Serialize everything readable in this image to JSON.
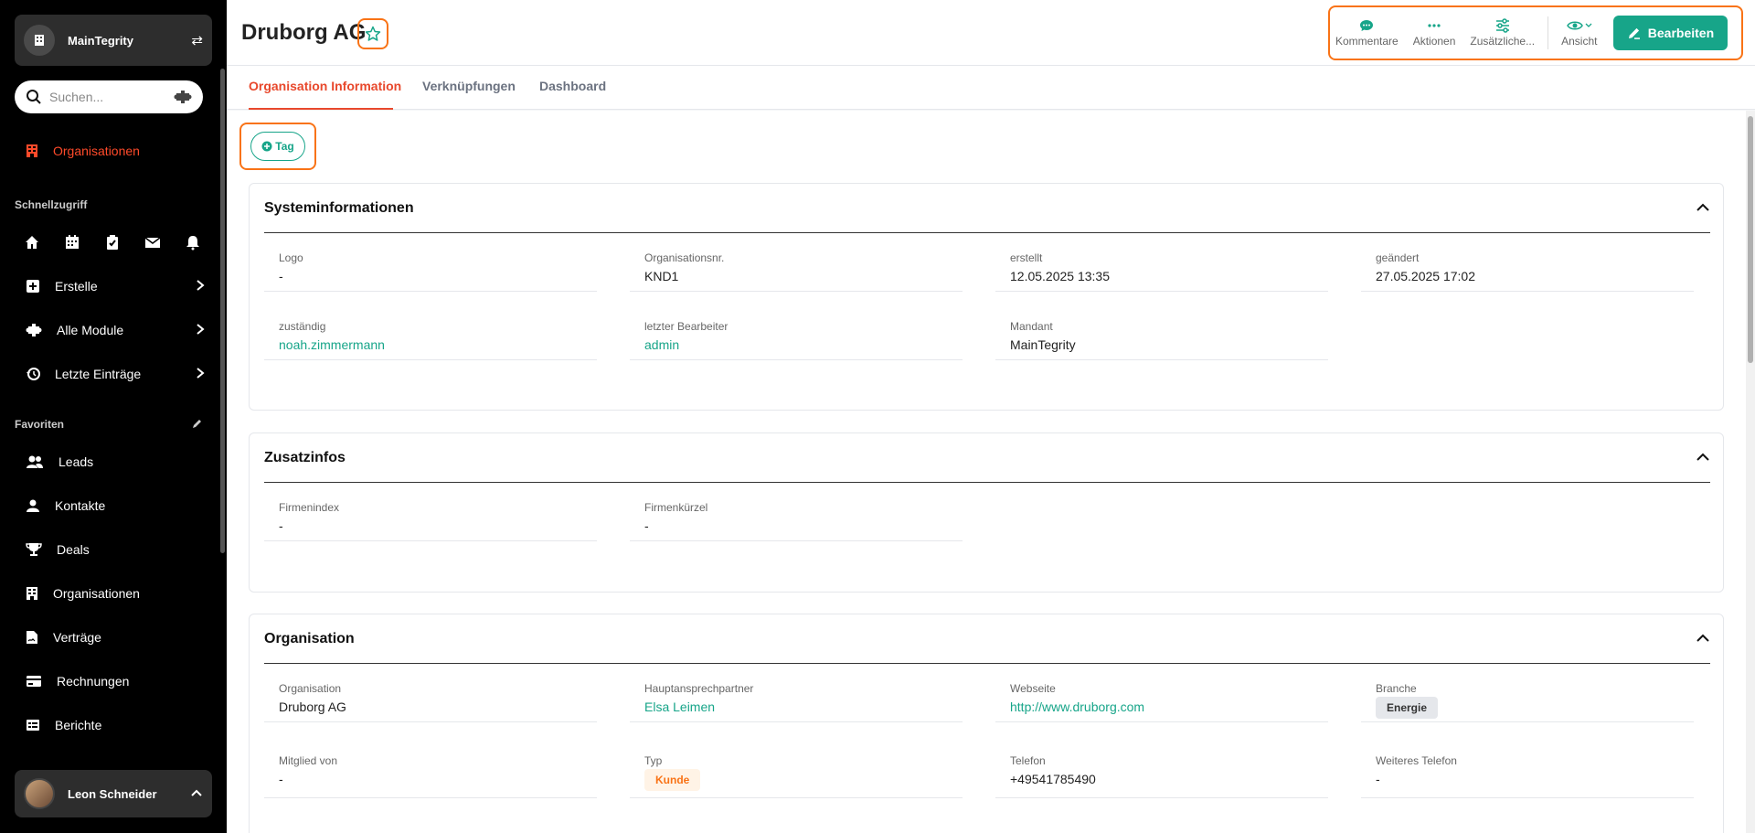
{
  "sidebar": {
    "org_name": "MainTegrity",
    "search_placeholder": "Suchen...",
    "active_item": "Organisationen",
    "quick_access_label": "Schnellzugriff",
    "menu": [
      {
        "label": "Erstelle"
      },
      {
        "label": "Alle Module"
      },
      {
        "label": "Letzte Einträge"
      }
    ],
    "favorites_label": "Favoriten",
    "favorites": [
      {
        "label": "Leads"
      },
      {
        "label": "Kontakte"
      },
      {
        "label": "Deals"
      },
      {
        "label": "Organisationen"
      },
      {
        "label": "Verträge"
      },
      {
        "label": "Rechnungen"
      },
      {
        "label": "Berichte"
      }
    ],
    "user_name": "Leon Schneider"
  },
  "header": {
    "title": "Druborg AG",
    "toolbar": {
      "comments": "Kommentare",
      "actions": "Aktionen",
      "additional": "Zusätzliche...",
      "view": "Ansicht",
      "edit": "Bearbeiten"
    }
  },
  "tabs": [
    {
      "label": "Organisation Information"
    },
    {
      "label": "Verknüpfungen"
    },
    {
      "label": "Dashboard"
    }
  ],
  "tag_label": "Tag",
  "sections": {
    "system": {
      "title": "Systeminformationen",
      "fields": [
        {
          "label": "Logo",
          "value": "-"
        },
        {
          "label": "Organisationsnr.",
          "value": "KND1"
        },
        {
          "label": "erstellt",
          "value": "12.05.2025 13:35"
        },
        {
          "label": "geändert",
          "value": "27.05.2025 17:02"
        },
        {
          "label": "zuständig",
          "value": "noah.zimmermann"
        },
        {
          "label": "letzter Bearbeiter",
          "value": "admin"
        },
        {
          "label": "Mandant",
          "value": "MainTegrity"
        }
      ]
    },
    "extra": {
      "title": "Zusatzinfos",
      "fields": [
        {
          "label": "Firmenindex",
          "value": "-"
        },
        {
          "label": "Firmenkürzel",
          "value": "-"
        }
      ]
    },
    "org": {
      "title": "Organisation",
      "fields": [
        {
          "label": "Organisation",
          "value": "Druborg AG"
        },
        {
          "label": "Hauptansprechpartner",
          "value": "Elsa Leimen"
        },
        {
          "label": "Webseite",
          "value": "http://www.druborg.com"
        },
        {
          "label": "Branche",
          "value": "Energie"
        },
        {
          "label": "Mitglied von",
          "value": "-"
        },
        {
          "label": "Typ",
          "value": "Kunde"
        },
        {
          "label": "Telefon",
          "value": "+49541785490"
        },
        {
          "label": "Weiteres Telefon",
          "value": "-"
        }
      ]
    }
  },
  "colors": {
    "accent": "#17a589",
    "active": "#e8482c",
    "highlight": "#f97316"
  }
}
